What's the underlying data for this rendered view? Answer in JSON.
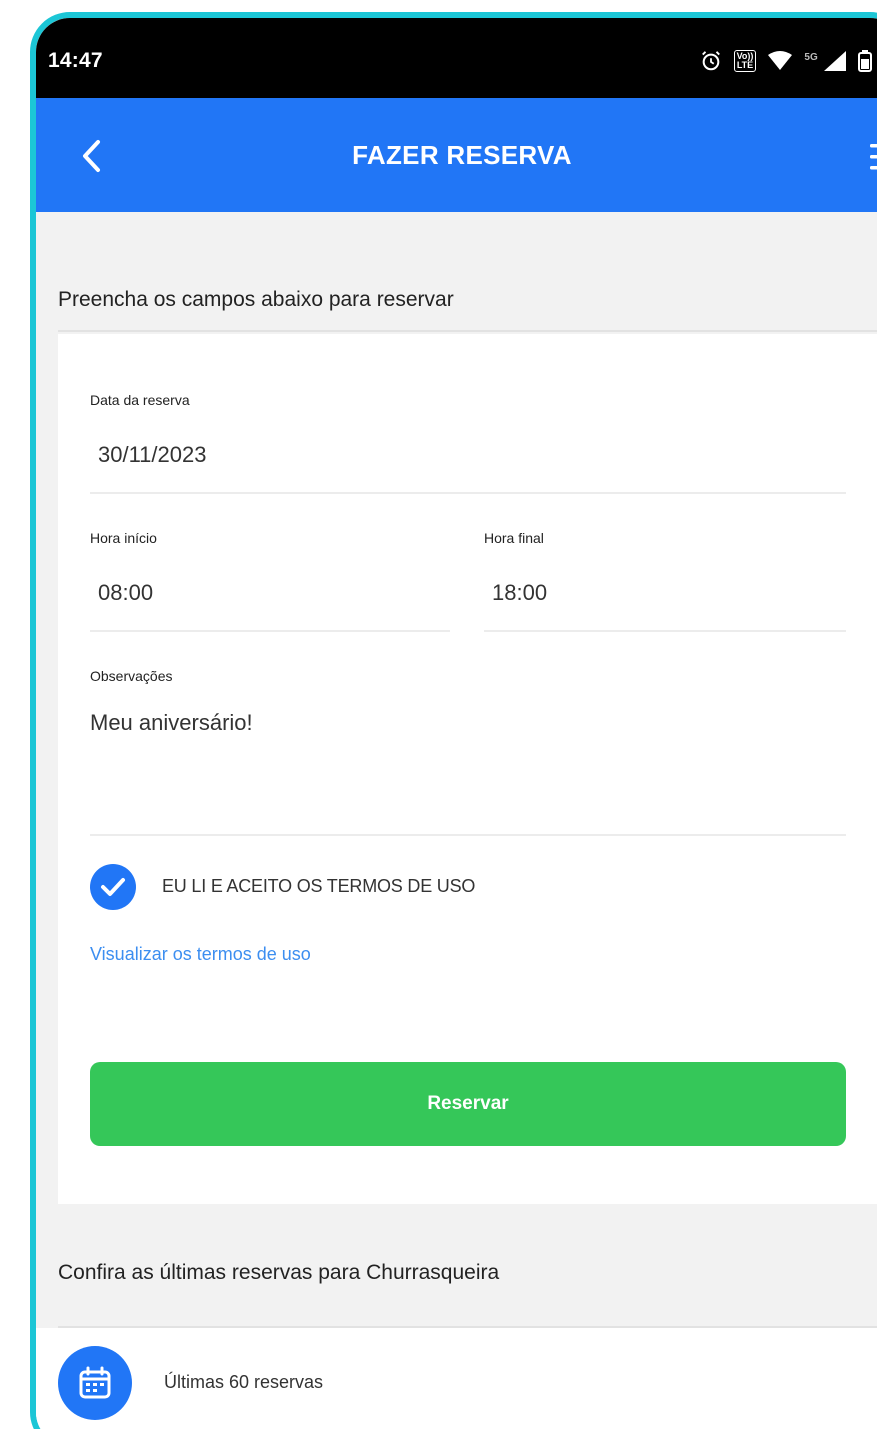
{
  "status_bar": {
    "time": "14:47",
    "network_badge_top": "Vo))",
    "network_badge_bottom": "LTE",
    "signal_type": "5G",
    "battery_percent": "76"
  },
  "app_bar": {
    "title": "FAZER RESERVA",
    "back_icon": "chevron-left-icon",
    "menu_icon": "hamburger-menu-icon"
  },
  "form": {
    "section_title": "Preencha os campos abaixo para reservar",
    "date": {
      "label": "Data da reserva",
      "value": "30/11/2023"
    },
    "start_time": {
      "label": "Hora início",
      "value": "08:00"
    },
    "end_time": {
      "label": "Hora final",
      "value": "18:00"
    },
    "notes": {
      "label": "Observações",
      "value": "Meu aniversário!"
    },
    "terms_checkbox": {
      "label": "EU LI E ACEITO OS TERMOS DE USO",
      "checked": true
    },
    "terms_link": "Visualizar os termos de uso",
    "submit_label": "Reservar"
  },
  "recent": {
    "section_title": "Confira as últimas reservas para Churrasqueira",
    "item_label": "Últimas 60 reservas",
    "item_icon": "calendar-icon"
  },
  "colors": {
    "primary": "#2176f6",
    "success": "#35c759",
    "link": "#3c8ef0",
    "frame": "#1cc6d6"
  }
}
